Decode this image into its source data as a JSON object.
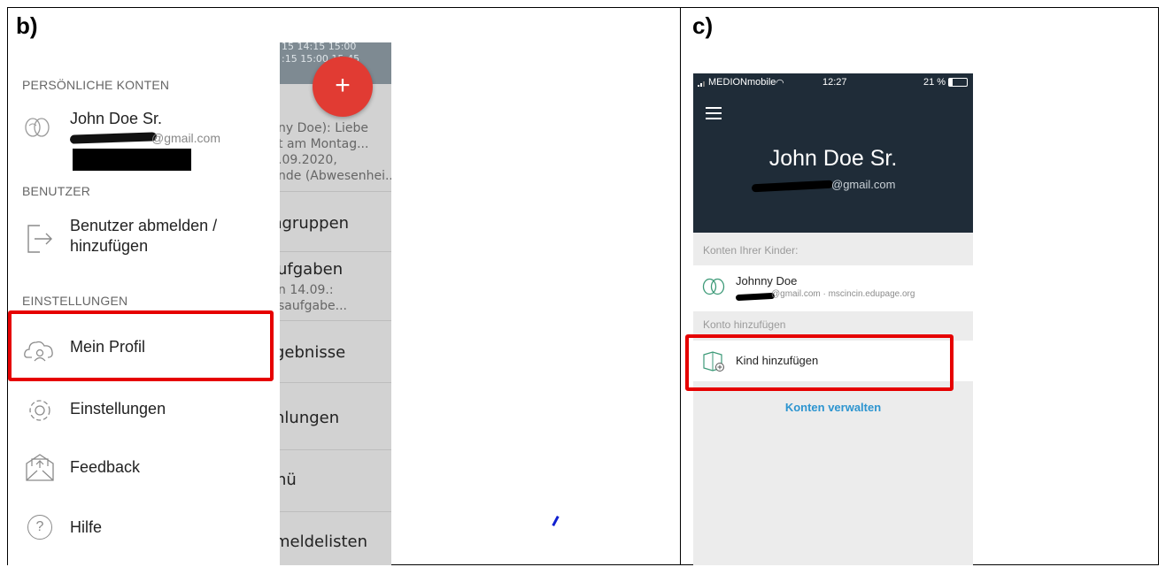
{
  "labels": {
    "panel_b": "b)",
    "panel_c": "c)"
  },
  "android_bg": {
    "times_row1": "15   14:15   15:00",
    "times_row2": ":15   15:00   15:45",
    "fab_plus": "+",
    "message_lines": [
      "ny Doe): Liebe",
      "t am Montag...",
      ".09.2020,",
      "nde (Abwesenhei..."
    ],
    "menu": [
      "rngruppen",
      "ufgaben",
      "n 14.09.:",
      "saufgabe...",
      "gebnisse",
      "nlungen",
      "nü",
      "meldelisten"
    ]
  },
  "drawer": {
    "personal_header": "PERSÖNLICHE KONTEN",
    "account_name": "John Doe Sr.",
    "account_email": "@gmail.com",
    "users_header": "BENUTZER",
    "logout_line1": "Benutzer abmelden /",
    "logout_line2": "hinzufügen",
    "settings_header": "EINSTELLUNGEN",
    "profile": "Mein Profil",
    "settings": "Einstellungen",
    "feedback": "Feedback",
    "help": "Hilfe",
    "help_glyph": "?"
  },
  "ios": {
    "carrier": "MEDIONmobile",
    "time": "12:27",
    "battery": "21 %",
    "name": "John Doe Sr.",
    "email": "@gmail.com",
    "children_header": "Konten Ihrer Kinder:",
    "child_name": "Johnny Doe",
    "child_detail": "@gmail.com · mscincin.edupage.org",
    "add_account_header": "Konto hinzufügen",
    "add_child": "Kind hinzufügen",
    "manage_accounts": "Konten verwalten"
  },
  "colors": {
    "highlight": "#e60000",
    "ios_header": "#1f2c38",
    "fab": "#e13b33",
    "link": "#2d95d0"
  }
}
